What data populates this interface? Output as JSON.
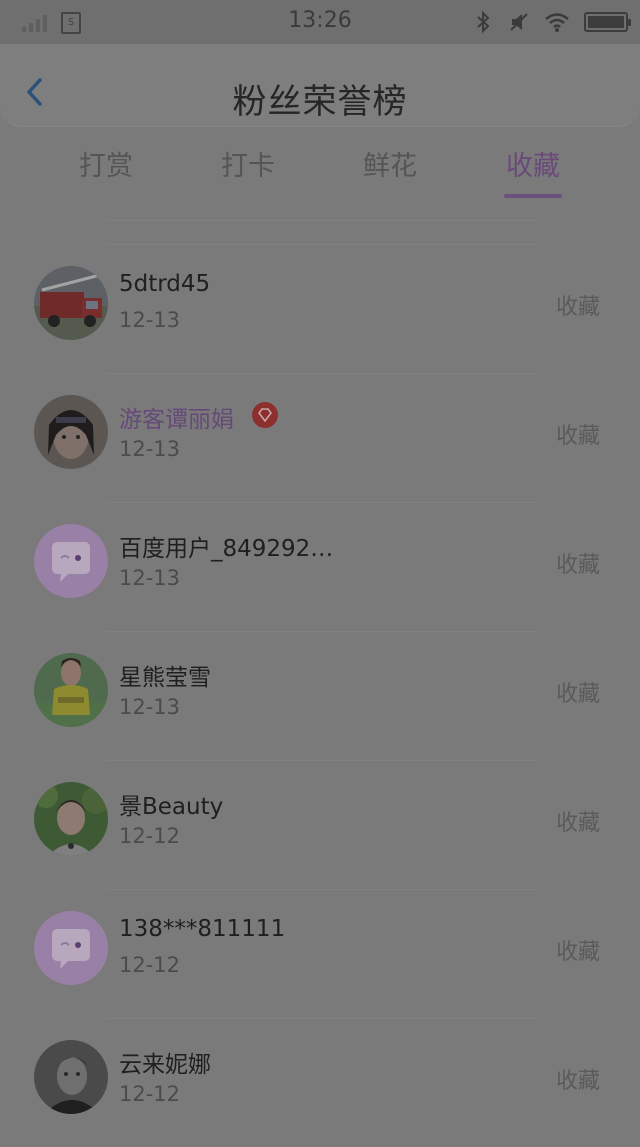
{
  "status_bar": {
    "time": "13:26"
  },
  "header": {
    "title": "粉丝荣誉榜"
  },
  "tabs": [
    {
      "label": "打赏"
    },
    {
      "label": "打卡"
    },
    {
      "label": "鲜花"
    },
    {
      "label": "收藏"
    }
  ],
  "active_tab": "收藏",
  "fans": [
    {
      "name": "5dtrd45",
      "date": "12-13",
      "action": "收藏",
      "avatar": "fire-truck-avatar",
      "vip": false
    },
    {
      "name": "游客谭丽娟",
      "date": "12-13",
      "action": "收藏",
      "avatar": "selfie-avatar",
      "vip": true
    },
    {
      "name": "百度用户_849292…",
      "date": "12-13",
      "action": "收藏",
      "avatar": "default-chat-avatar",
      "vip": false
    },
    {
      "name": "星熊莹雪",
      "date": "12-13",
      "action": "收藏",
      "avatar": "yellow-shirt-avatar",
      "vip": false
    },
    {
      "name": "景Beauty",
      "date": "12-12",
      "action": "收藏",
      "avatar": "outdoor-portrait-avatar",
      "vip": false
    },
    {
      "name": "138***811111",
      "date": "12-12",
      "action": "收藏",
      "avatar": "default-chat-avatar",
      "vip": false
    },
    {
      "name": "云来妮娜",
      "date": "12-12",
      "action": "收藏",
      "avatar": "dark-portrait-avatar",
      "vip": false
    }
  ],
  "colors": {
    "accent": "#6b4f7c",
    "overlay": "#7a7a7a",
    "avatar_default": "#9980a6"
  }
}
